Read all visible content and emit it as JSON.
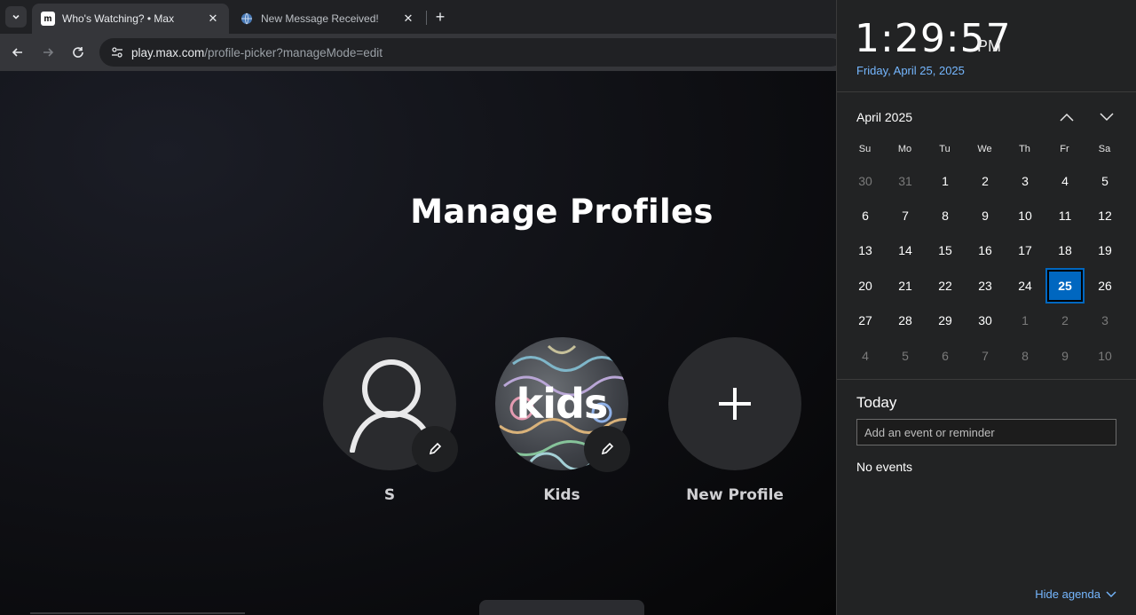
{
  "browser": {
    "tabs": [
      {
        "title": "Who's Watching? • Max",
        "favicon": "max-logo-icon",
        "active": true
      },
      {
        "title": "New Message Received!",
        "favicon": "globe-icon",
        "active": false
      }
    ],
    "url_host": "play.max.com",
    "url_path": "/profile-picker?manageMode=edit"
  },
  "page": {
    "title": "Manage Profiles",
    "profiles": [
      {
        "name": "S",
        "avatar": "person-icon"
      },
      {
        "name": "Kids",
        "avatar_text": "kids"
      },
      {
        "name": "New Profile",
        "avatar": "plus-icon"
      }
    ]
  },
  "calendar": {
    "time": "1:29:57",
    "ampm": "PM",
    "date": "Friday, April 25, 2025",
    "month": "April 2025",
    "weekdays": [
      "Su",
      "Mo",
      "Tu",
      "We",
      "Th",
      "Fr",
      "Sa"
    ],
    "days": [
      "30",
      "31",
      "1",
      "2",
      "3",
      "4",
      "5",
      "6",
      "7",
      "8",
      "9",
      "10",
      "11",
      "12",
      "13",
      "14",
      "15",
      "16",
      "17",
      "18",
      "19",
      "20",
      "21",
      "22",
      "23",
      "24",
      "25",
      "26",
      "27",
      "28",
      "29",
      "30",
      "1",
      "2",
      "3",
      "4",
      "5",
      "6",
      "7",
      "8",
      "9",
      "10"
    ],
    "today_index": 26,
    "today_label": "Today",
    "event_placeholder": "Add an event or reminder",
    "no_events": "No events",
    "hide_agenda": "Hide agenda",
    "accent_color": "#0067c0",
    "link_color": "#75b7ff"
  }
}
